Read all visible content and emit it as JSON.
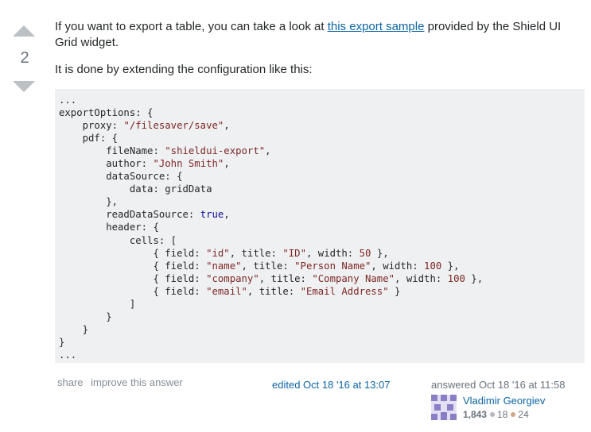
{
  "vote": {
    "count": "2"
  },
  "post": {
    "p1_before": "If you want to export a table, you can take a look at ",
    "p1_link": "this export sample",
    "p1_after": " provided by the Shield UI Grid widget.",
    "p2": "It is done by extending the configuration like this:"
  },
  "footer": {
    "share": "share",
    "improve": "improve this answer",
    "edited": "edited Oct 18 '16 at 13:07",
    "answered": "answered Oct 18 '16 at 11:58",
    "user_name": "Vladimir Georgiev",
    "reputation": "1,843",
    "silver": "18",
    "bronze": "24"
  },
  "colors": {
    "accent": "#0c65a5",
    "code_bg": "#eff0f1",
    "vote_arrow": "#bbc0c4"
  },
  "icons": [
    "upvote-icon",
    "downvote-icon",
    "identicon-avatar"
  ]
}
